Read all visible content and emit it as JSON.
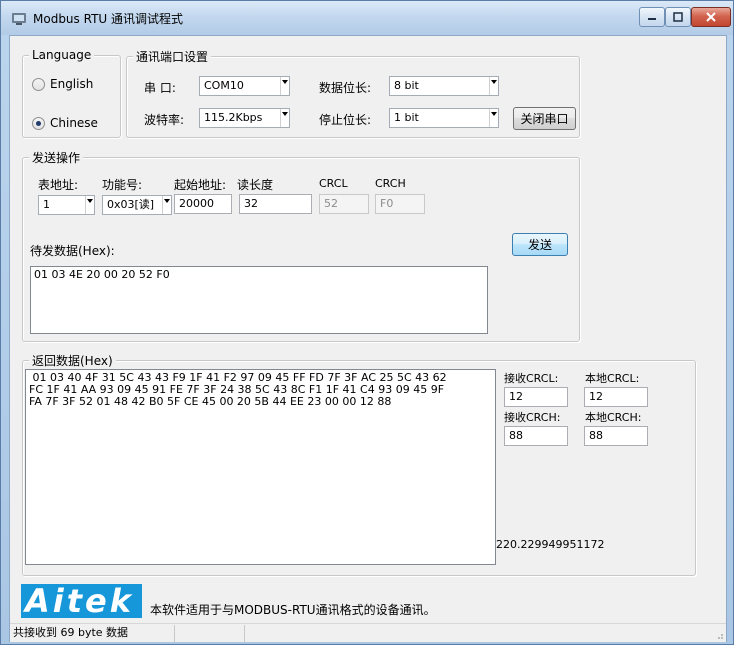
{
  "window": {
    "title": "Modbus RTU 通讯调试程式"
  },
  "language_group": {
    "title": "Language",
    "options": [
      {
        "label": "English",
        "selected": false
      },
      {
        "label": "Chinese",
        "selected": true
      }
    ]
  },
  "port_group": {
    "title": "通讯端口设置",
    "port_label": "串  口:",
    "port_value": "COM10",
    "baud_label": "波特率:",
    "baud_value": "115.2Kbps",
    "databits_label": "数据位长:",
    "databits_value": "8 bit",
    "stopbits_label": "停止位长:",
    "stopbits_value": "1 bit",
    "close_port_button": "关闭串口"
  },
  "send_group": {
    "title": "发送操作",
    "addr_label": "表地址:",
    "addr_value": "1",
    "func_label": "功能号:",
    "func_value": "0x03[读]",
    "start_label": "起始地址:",
    "start_value": "20000",
    "len_label": "读长度",
    "len_value": "32",
    "crcl_label": "CRCL",
    "crcl_value": "52",
    "crch_label": "CRCH",
    "crch_value": "F0",
    "pending_label": "待发数据(Hex):",
    "send_button": "发送",
    "pending_data": "01 03 4E 20 00 20 52 F0"
  },
  "return_group": {
    "title": "返回数据(Hex)",
    "data": " 01 03 40 4F 31 5C 43 43 F9 1F 41 F2 97 09 45 FF FD 7F 3F AC 25 5C 43 62\nFC 1F 41 AA 93 09 45 91 FE 7F 3F 24 38 5C 43 8C F1 1F 41 C4 93 09 45 9F\nFA 7F 3F 52 01 48 42 B0 5F CE 45 00 20 5B 44 EE 23 00 00 12 88",
    "recv_crcl_label": "接收CRCL:",
    "recv_crcl_value": "12",
    "local_crcl_label": "本地CRCL:",
    "local_crcl_value": "12",
    "recv_crch_label": "接收CRCH:",
    "recv_crch_value": "88",
    "local_crch_label": "本地CRCH:",
    "local_crch_value": "88",
    "float_readout": "220.229949951172"
  },
  "footer": {
    "logo": "Aitek",
    "description": "本软件适用于与MODBUS-RTU通讯格式的设备通讯。"
  },
  "statusbar": {
    "text": "共接收到 69 byte 数据"
  },
  "colors": {
    "logo_bg": "#1597d9",
    "close_btn": "#c94a34"
  }
}
